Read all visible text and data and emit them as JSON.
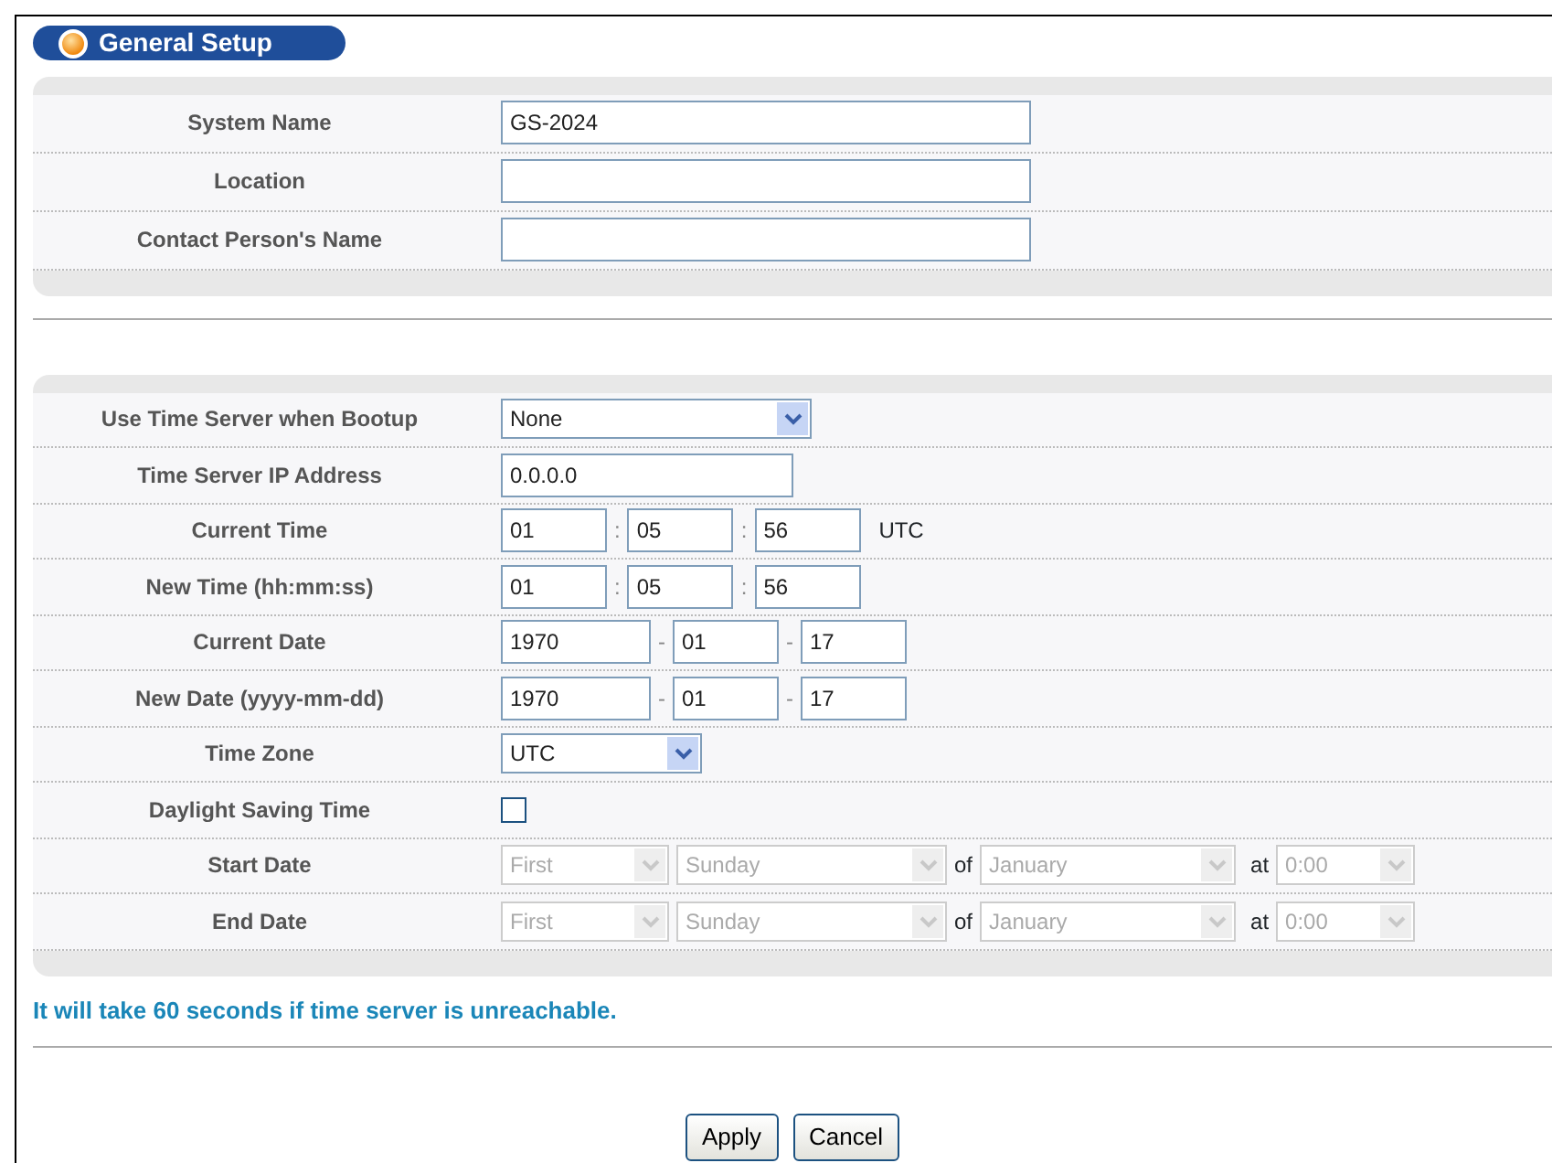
{
  "title": "General Setup",
  "system": [
    {
      "label": "System Name",
      "value": "GS-2024"
    },
    {
      "label": "Location"
    },
    {
      "label": "Contact Person's Name"
    }
  ],
  "time_rows": [
    {
      "kind": "select",
      "label": "Use Time Server when Bootup",
      "value": "None"
    },
    {
      "kind": "text",
      "label": "Time Server IP Address",
      "value": "0.0.0.0"
    },
    {
      "kind": "time",
      "label": "Current Time",
      "parts": [
        "01",
        "05",
        "56"
      ],
      "separators": [
        ":",
        ":"
      ],
      "suffix": "UTC"
    },
    {
      "kind": "time",
      "label": "New Time (hh:mm:ss)",
      "parts": [
        "01",
        "05",
        "56"
      ],
      "separators": [
        ":",
        ":"
      ]
    },
    {
      "kind": "date",
      "label": "Current Date",
      "parts": [
        "1970",
        "01",
        "17"
      ],
      "separators": [
        "-",
        "-"
      ]
    },
    {
      "kind": "date",
      "label": "New Date (yyyy-mm-dd)",
      "parts": [
        "1970",
        "01",
        "17"
      ],
      "separators": [
        "-",
        "-"
      ]
    },
    {
      "kind": "select",
      "label": "Time Zone",
      "value": "UTC"
    },
    {
      "kind": "checkbox",
      "label": "Daylight Saving Time",
      "checked": false
    },
    {
      "kind": "dst",
      "label": "Start Date",
      "disabled": true,
      "week": "First",
      "day": "Sunday",
      "of": "of",
      "month": "January",
      "at": "at",
      "hour": "0:00"
    },
    {
      "kind": "dst",
      "label": "End Date",
      "disabled": true,
      "week": "First",
      "day": "Sunday",
      "of": "of",
      "month": "January",
      "at": "at",
      "hour": "0:00"
    }
  ],
  "note": "It will take 60 seconds if time server is unreachable.",
  "buttons": [
    "Apply",
    "Cancel"
  ]
}
